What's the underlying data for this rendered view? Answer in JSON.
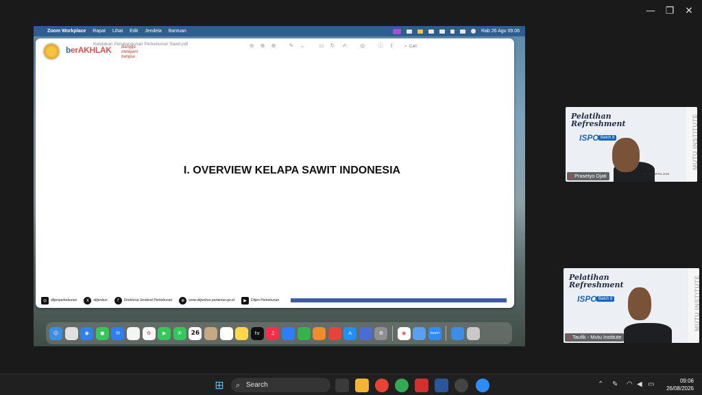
{
  "window": {
    "minimize_glyph": "—",
    "restore_glyph": "❐",
    "close_glyph": "✕"
  },
  "mac_menubar": {
    "apple_glyph": "",
    "app_name": "Zoom Workplace",
    "items": [
      "Rapat",
      "Lihat",
      "Edit",
      "Jendela",
      "Bantuan"
    ],
    "datetime": "Rab 26 Agu  09.06"
  },
  "pdf": {
    "title": "Kebijakan Pembangunan Perkebunan Sawit.pdf",
    "search_placeholder": "Cari",
    "logo_berakhlak": "erAKHLAK",
    "logo_berakhlak_prefix": "b",
    "logo_tagline": "Bangga melayani bangsa",
    "slide_title": "I. OVERVIEW KELAPA SAWIT INDONESIA",
    "footer": {
      "instagram": "ditjenperkebunan",
      "x": "ditjenbun",
      "facebook": "Direktorat Jenderal Perkebunan",
      "website": "www.ditjenbun.pertanian.go.id",
      "youtube": "Ditjen Perkebunan"
    },
    "footer_bar_color": "#3e5aa8"
  },
  "dock": {
    "calendar_day": "26",
    "tv_label": "tv",
    "zoom_label": "zoom",
    "badge": "4"
  },
  "participants": [
    {
      "name": "Prasetyo Djati",
      "banner_line1": "Pelatihan",
      "banner_line2": "Refreshment",
      "ispo": "ISPO",
      "batch": "Batch 8",
      "side_text": "MUTU INSTITUTE",
      "date_text": "24 - 27 | APRIL 2026"
    },
    {
      "name": "Taufik - Mutu Institute",
      "banner_line1": "Pelatihan",
      "banner_line2": "Refreshment",
      "ispo": "ISPO",
      "batch": "Batch 8",
      "side_text": "MUTU INSTITUTE"
    }
  ],
  "taskbar": {
    "search_label": "Search",
    "time": "09:06",
    "date": "26/08/2026"
  },
  "colors": {
    "mac_menubar": "#2c5f8f",
    "accent_blue": "#1565c0",
    "taskbar": "#202020"
  }
}
